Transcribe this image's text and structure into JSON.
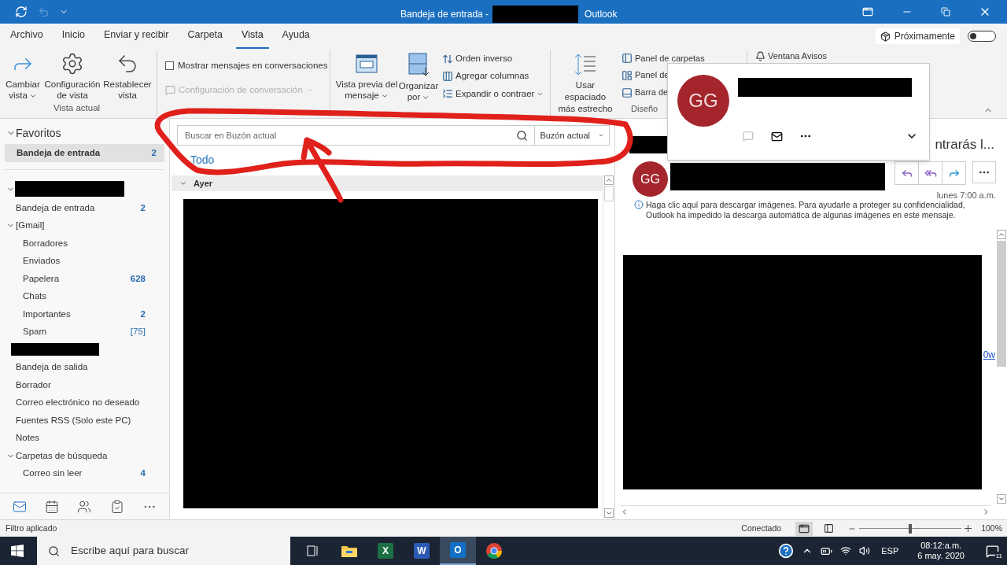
{
  "window": {
    "title_prefix": "Bandeja de entrada -",
    "app": "Outlook"
  },
  "ribbon_tabs": [
    {
      "label": "Archivo",
      "selected": false
    },
    {
      "label": "Inicio",
      "selected": false
    },
    {
      "label": "Enviar y recibir",
      "selected": false
    },
    {
      "label": "Carpeta",
      "selected": false
    },
    {
      "label": "Vista",
      "selected": true
    },
    {
      "label": "Ayuda",
      "selected": false
    }
  ],
  "coming_soon": {
    "label": "Próximamente",
    "on": false
  },
  "ribbon": {
    "current_view": {
      "label": "Vista actual",
      "buttons": [
        {
          "lines": [
            "Cambiar",
            "vista"
          ],
          "dropdown": true
        },
        {
          "lines": [
            "Configuración",
            "de vista"
          ],
          "dropdown": false
        },
        {
          "lines": [
            "Restablecer",
            "vista"
          ],
          "dropdown": false
        }
      ]
    },
    "messages": {
      "checkbox": {
        "label": "Mostrar mensajes en conversaciones",
        "checked": false
      },
      "settings": {
        "label": "Configuración de conversación",
        "disabled": true
      }
    },
    "arrangement": {
      "buttons": [
        {
          "lines": [
            "Vista previa del",
            "mensaje"
          ],
          "dropdown": true
        },
        {
          "lines": [
            "Organizar",
            "por"
          ],
          "dropdown": true
        }
      ],
      "small": [
        {
          "label": "Orden inverso",
          "dropdown": false
        },
        {
          "label": "Agregar columnas",
          "dropdown": false
        },
        {
          "label": "Expandir o contraer",
          "dropdown": true
        }
      ]
    },
    "spacing": {
      "lines": [
        "Usar espaciado",
        "más estrecho"
      ]
    },
    "layout": {
      "label": "Diseño",
      "items": [
        "Panel de carpetas",
        "Panel de",
        "Barra de"
      ]
    },
    "reminders": {
      "label": "Ventana Avisos"
    }
  },
  "nav": {
    "favorites": {
      "label": "Favoritos",
      "expanded": true,
      "items": [
        {
          "label": "Bandeja de entrada",
          "count": "2",
          "selected": true
        }
      ]
    },
    "account": {
      "expanded": true,
      "folders": [
        {
          "kind": "folder",
          "label": "Bandeja de entrada",
          "count": "2",
          "bold": true
        },
        {
          "kind": "folder",
          "label": "[Gmail]",
          "expanded": true,
          "children": [
            {
              "kind": "folder",
              "label": "Borradores"
            },
            {
              "kind": "folder",
              "label": "Enviados"
            },
            {
              "kind": "folder",
              "label": "Papelera",
              "count": "628",
              "bold": true
            },
            {
              "kind": "folder",
              "label": "Chats"
            },
            {
              "kind": "folder",
              "label": "Importantes",
              "count": "2",
              "bold": true
            },
            {
              "kind": "folder",
              "label": "Spam",
              "count": "[75]",
              "bold": false
            }
          ]
        },
        {
          "kind": "redacted"
        },
        {
          "kind": "folder",
          "label": "Bandeja de salida"
        },
        {
          "kind": "folder",
          "label": "Borrador"
        },
        {
          "kind": "folder",
          "label": "Correo electrónico no deseado"
        },
        {
          "kind": "folder",
          "label": "Fuentes RSS (Solo este PC)"
        },
        {
          "kind": "folder",
          "label": "Notes"
        },
        {
          "kind": "folder",
          "label": "Carpetas de búsqueda",
          "expanded": true,
          "children": [
            {
              "kind": "folder",
              "label": "Correo sin leer",
              "count": "4",
              "bold": true
            }
          ]
        }
      ]
    },
    "modules": [
      {
        "selected": true
      },
      {
        "selected": false
      },
      {
        "selected": false
      },
      {
        "selected": false
      },
      {
        "selected": false
      }
    ]
  },
  "message_list": {
    "search": {
      "placeholder": "Buscar en Buzón actual",
      "scope": "Buzón actual"
    },
    "filters": [
      {
        "label": "Todo",
        "selected": true
      }
    ],
    "group": {
      "label": "Ayer",
      "expanded": true
    }
  },
  "reading_pane": {
    "subject": "ntrarás l...",
    "avatar": "GG",
    "time": "lunes 7:00 a.m.",
    "notice": "Haga clic aquí para descargar imágenes. Para ayudarle a proteger su confidencialidad, Outlook ha impedido la descarga automática de algunas imágenes en este mensaje.",
    "link_fragment": "0w"
  },
  "contact_card": {
    "avatar": "GG"
  },
  "status_bar": {
    "left": "Filtro aplicado",
    "connection": "Conectado",
    "zoom": {
      "level": 0.5,
      "reading": "100%"
    }
  },
  "taskbar": {
    "search_placeholder": "Escribe aquí para buscar",
    "apps": [
      {
        "kind": "taskview",
        "selected": false
      },
      {
        "kind": "explorer",
        "selected": false
      },
      {
        "kind": "excel",
        "glyph": "X",
        "selected": false
      },
      {
        "kind": "word",
        "glyph": "W",
        "selected": false
      },
      {
        "kind": "outlook",
        "glyph": "O",
        "selected": true
      },
      {
        "kind": "chrome",
        "selected": false
      }
    ],
    "language": "ESP",
    "time": "08:12:a.m.",
    "date": "6 may. 2020",
    "notifications": "11"
  }
}
